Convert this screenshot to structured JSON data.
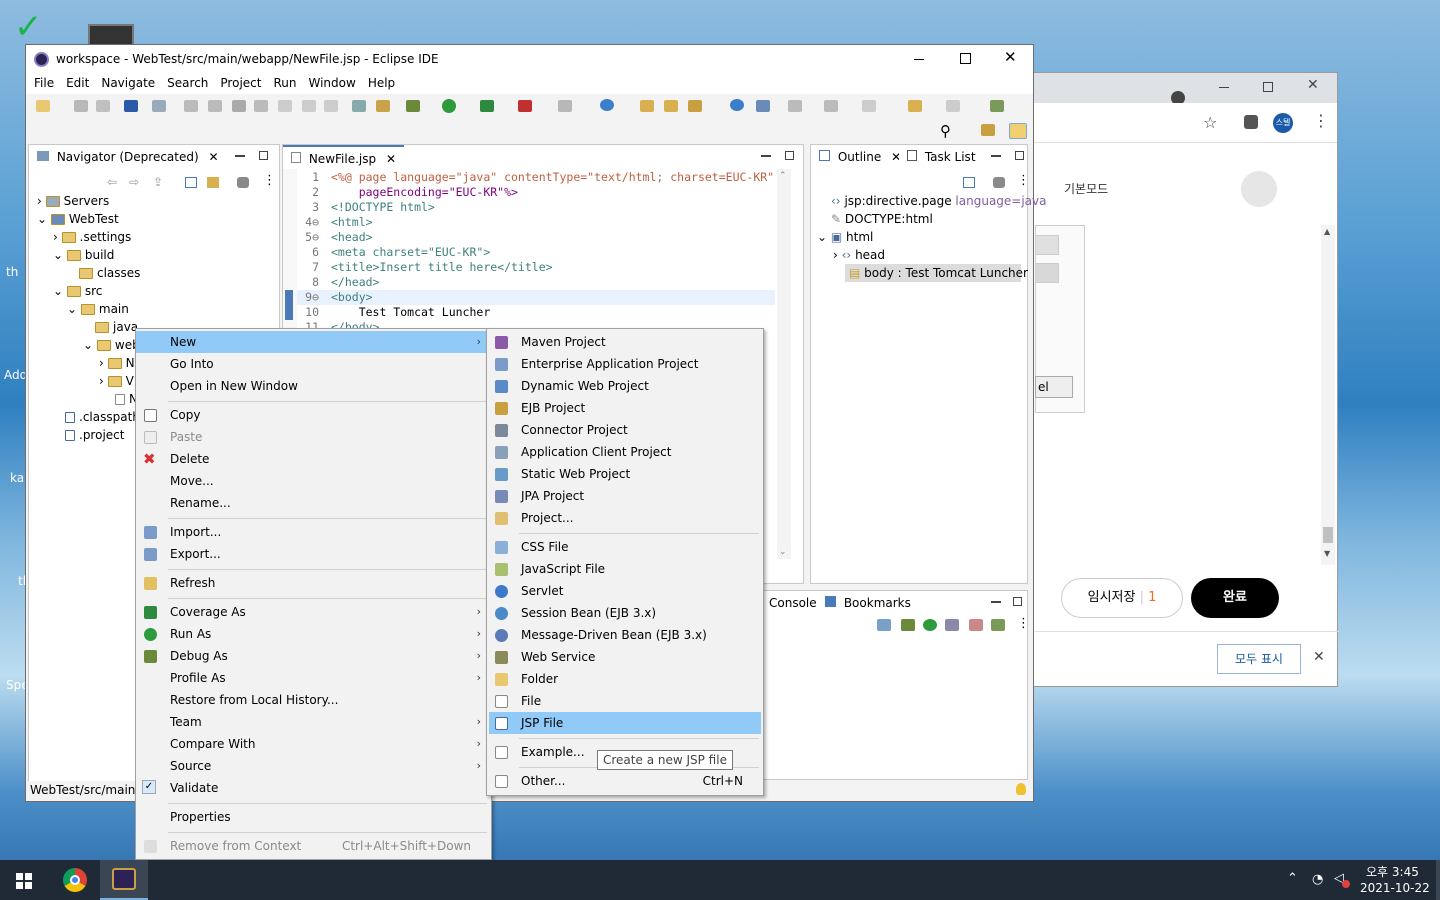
{
  "desktop": {
    "labels": [
      "th",
      "Add",
      "kai",
      "tl",
      "Spe"
    ]
  },
  "chrome": {
    "mode_label": "기본모드",
    "save_label": "임시저장",
    "save_count": "1",
    "done_label": "완료",
    "showall_label": "모두 표시",
    "avatar_label": "스텔",
    "partial_label": "el"
  },
  "eclipse": {
    "title": "workspace - WebTest/src/main/webapp/NewFile.jsp - Eclipse IDE",
    "menus": [
      "File",
      "Edit",
      "Navigate",
      "Search",
      "Project",
      "Run",
      "Window",
      "Help"
    ],
    "navigator": {
      "tab": "Navigator (Deprecated)",
      "items": [
        "Servers",
        "WebTest",
        ".settings",
        "build",
        "classes",
        "src",
        "main",
        "java",
        "web",
        ".classpath",
        ".project"
      ],
      "short_items": [
        "N",
        "V",
        "N"
      ]
    },
    "editor": {
      "tab": "NewFile.jsp",
      "lines": [
        {
          "n": "1",
          "t": "<%@ page language=\"java\" contentType=\"text/html; charset=EUC-KR\""
        },
        {
          "n": "2",
          "t": "    pageEncoding=\"EUC-KR\"%>"
        },
        {
          "n": "3",
          "t": "<!DOCTYPE html>"
        },
        {
          "n": "4⊖",
          "t": "<html>"
        },
        {
          "n": "5⊖",
          "t": "<head>"
        },
        {
          "n": "6",
          "t": "<meta charset=\"EUC-KR\">"
        },
        {
          "n": "7",
          "t": "<title>Insert title here</title>"
        },
        {
          "n": "8",
          "t": "</head>"
        },
        {
          "n": "9⊖",
          "t": "<body>"
        },
        {
          "n": "10",
          "t": "    Test Tomcat Luncher"
        },
        {
          "n": "11",
          "t": "</body>"
        }
      ]
    },
    "outline": {
      "tab": "Outline",
      "tab2": "Task List",
      "items": [
        "jsp:directive.page",
        "DOCTYPE:html",
        "html",
        "head",
        "body : Test Tomcat Luncher"
      ],
      "directive_attr": "language=java"
    },
    "console": {
      "tab": "Console",
      "tab2": "Bookmarks"
    },
    "status": "WebTest/src/main/v"
  },
  "context_menu": {
    "items": [
      {
        "label": "New",
        "submenu": true,
        "selected": true
      },
      {
        "label": "Go Into"
      },
      {
        "label": "Open in New Window"
      },
      {
        "label": "Copy"
      },
      {
        "label": "Paste",
        "disabled": true
      },
      {
        "label": "Delete"
      },
      {
        "label": "Move..."
      },
      {
        "label": "Rename..."
      },
      {
        "label": "Import..."
      },
      {
        "label": "Export..."
      },
      {
        "label": "Refresh"
      },
      {
        "label": "Coverage As",
        "submenu": true
      },
      {
        "label": "Run As",
        "submenu": true
      },
      {
        "label": "Debug As",
        "submenu": true
      },
      {
        "label": "Profile As",
        "submenu": true
      },
      {
        "label": "Restore from Local History..."
      },
      {
        "label": "Team",
        "submenu": true
      },
      {
        "label": "Compare With",
        "submenu": true
      },
      {
        "label": "Source",
        "submenu": true
      },
      {
        "label": "Validate",
        "checked": true
      },
      {
        "label": "Properties"
      },
      {
        "label": "Remove from Context",
        "shortcut": "Ctrl+Alt+Shift+Down",
        "disabled": true
      }
    ]
  },
  "new_submenu": {
    "items": [
      {
        "label": "Maven Project"
      },
      {
        "label": "Enterprise Application Project"
      },
      {
        "label": "Dynamic Web Project"
      },
      {
        "label": "EJB Project"
      },
      {
        "label": "Connector Project"
      },
      {
        "label": "Application Client Project"
      },
      {
        "label": "Static Web Project"
      },
      {
        "label": "JPA Project"
      },
      {
        "label": "Project..."
      },
      {
        "label": "CSS File"
      },
      {
        "label": "JavaScript File"
      },
      {
        "label": "Servlet"
      },
      {
        "label": "Session Bean (EJB 3.x)"
      },
      {
        "label": "Message-Driven Bean (EJB 3.x)"
      },
      {
        "label": "Web Service"
      },
      {
        "label": "Folder"
      },
      {
        "label": "File"
      },
      {
        "label": "JSP File",
        "selected": true
      },
      {
        "label": "Example..."
      },
      {
        "label": "Other...",
        "shortcut": "Ctrl+N"
      }
    ]
  },
  "tooltip": "Create a new JSP file",
  "taskbar": {
    "time": "오후 3:45",
    "date": "2021-10-22"
  }
}
